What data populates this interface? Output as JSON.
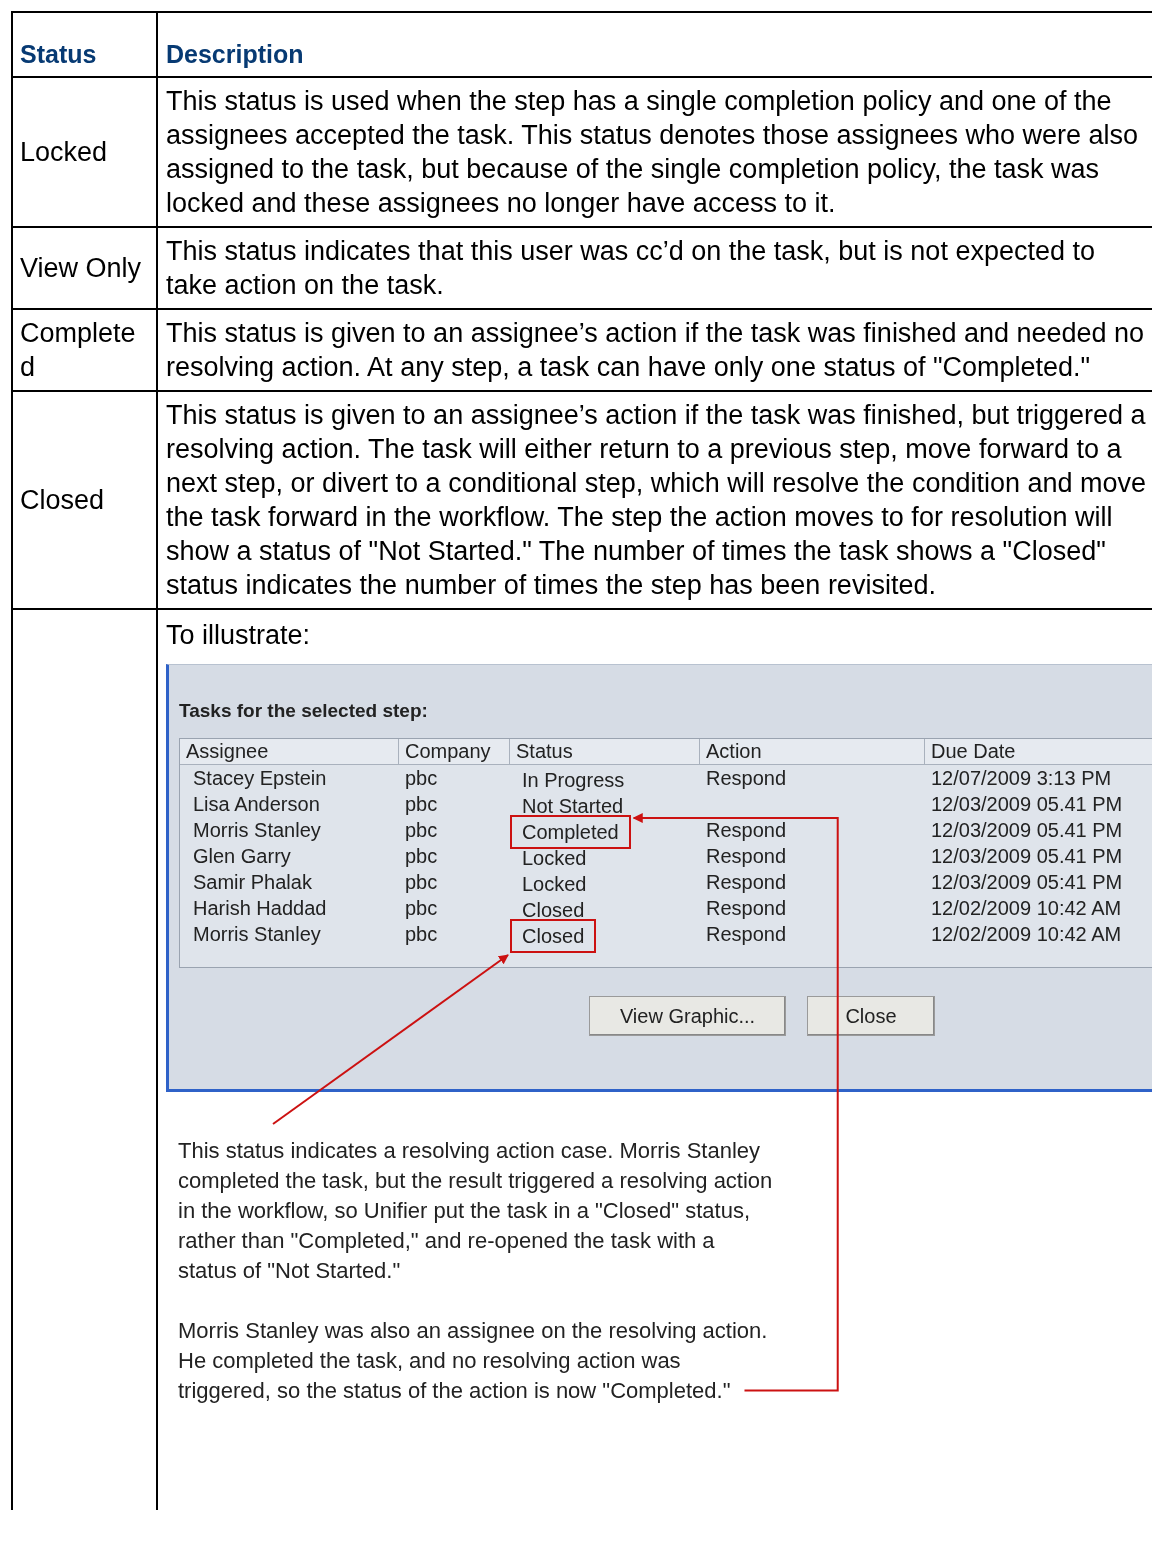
{
  "table": {
    "columns": [
      "Status",
      "Description"
    ],
    "rows": [
      {
        "status": "Locked",
        "description": "This status is used when the step has a single completion policy and one of the assignees accepted the task. This status denotes those assignees who were also assigned to the task, but because of the single completion policy, the task was locked and these assignees no longer have access to it."
      },
      {
        "status": "View Only",
        "description": "This status indicates that this user was cc’d on the task, but is not expected to take action on the task."
      },
      {
        "status": "Completed",
        "description": "This status is given to an assignee’s action if the task was finished and needed no resolving action. At any step, a task can have only one status of \"Completed.\""
      },
      {
        "status": "Closed",
        "description": "This status is given to an assignee’s action if the task was finished, but triggered a resolving action. The task will either return to a previous step, move forward to a next step, or divert to a conditional step, which will resolve the condition and move the task forward in the workflow. The step the action moves to for resolution will show a status of \"Not Started.\" The number of times the task shows a \"Closed\" status indicates the number of times the step has been revisited."
      }
    ],
    "illustration": {
      "intro": "To illustrate:",
      "dialog": {
        "heading": "Tasks for the selected step:",
        "columns": [
          "Assignee",
          "Company",
          "Status",
          "Action",
          "Due Date"
        ],
        "rows": [
          {
            "assignee": "Stacey Epstein",
            "company": "pbc",
            "status": "In Progress",
            "action": "Respond",
            "due": "12/07/2009 3:13 PM",
            "highlighted": false
          },
          {
            "assignee": "Lisa Anderson",
            "company": "pbc",
            "status": "Not Started",
            "due": "12/03/2009 05.41 PM",
            "highlighted": false
          },
          {
            "assignee": "Morris Stanley",
            "company": "pbc",
            "status": "Completed",
            "action": "Respond",
            "due": "12/03/2009 05.41 PM",
            "highlighted": true
          },
          {
            "assignee": "Glen Garry",
            "company": "pbc",
            "status": "Locked",
            "action": "Respond",
            "due": "12/03/2009 05.41 PM",
            "highlighted": false
          },
          {
            "assignee": "Samir Phalak",
            "company": "pbc",
            "status": "Locked",
            "action": "Respond",
            "due": "12/03/2009 05:41 PM",
            "highlighted": false
          },
          {
            "assignee": "Harish Haddad",
            "company": "pbc",
            "status": "Closed",
            "action": "Respond",
            "due": "12/02/2009 10:42 AM",
            "highlighted": false
          },
          {
            "assignee": "Morris Stanley",
            "company": "pbc",
            "status": "Closed",
            "action": "Respond",
            "due": "12/02/2009 10:42 AM",
            "highlighted": true
          }
        ],
        "buttons": [
          "View Graphic...",
          "Close"
        ]
      },
      "callouts": [
        "This status indicates a resolving action case. Morris Stanley completed the task, but the result triggered a resolving action in the workflow, so Unifier put the task in a \"Closed\" status, rather than \"Completed,\" and re-opened the task with a status of \"Not Started.\"",
        "Morris Stanley was also an assignee on the resolving action. He completed the task, and no resolving action was triggered, so the status of the action is now \"Completed.\""
      ]
    }
  }
}
